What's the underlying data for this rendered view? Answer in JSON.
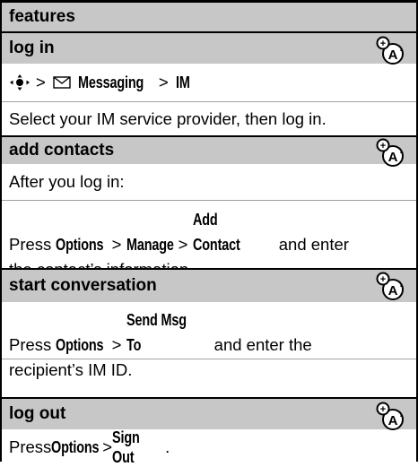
{
  "header": {
    "title": "features"
  },
  "sections": [
    {
      "title": "log in",
      "icon": "network-feature-icon",
      "nav": {
        "sep1": ">",
        "messaging": "Messaging",
        "sep2": ">",
        "im": "IM",
        "icons": [
          "nav-key-icon",
          "envelope-icon"
        ]
      },
      "text": "Select your IM service provider, then log in."
    },
    {
      "title": "add contacts",
      "icon": "network-feature-icon",
      "text1": "After you log in:",
      "line2": {
        "press": "Press ",
        "options": "Options",
        "gt1": " > ",
        "manage": "Manage",
        "gt2": " > ",
        "add_contact": "Add Contact",
        "rest": " and enter"
      },
      "line3": "the contact’s information."
    },
    {
      "title": "start conversation",
      "icon": "network-feature-icon",
      "line1": {
        "press": "Press ",
        "options": "Options",
        "gt": " > ",
        "send": "Send Msg To",
        "rest": " and enter the"
      },
      "line2": "recipient’s IM ID."
    },
    {
      "title": "log out",
      "icon": "network-feature-icon",
      "line1": {
        "press": "Press ",
        "options": "Options",
        "gt": " > ",
        "signout": "Sign Out",
        "end": "."
      }
    }
  ]
}
